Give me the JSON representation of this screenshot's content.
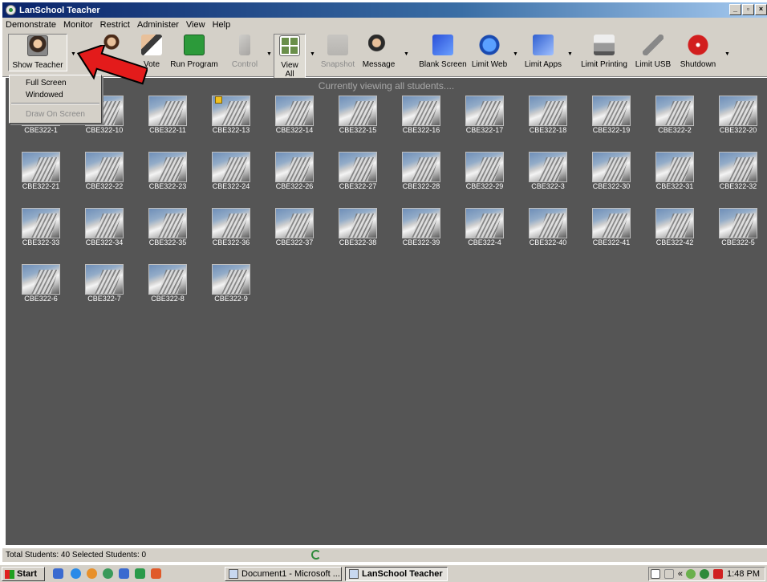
{
  "window": {
    "title": "LanSchool Teacher"
  },
  "menu": [
    "Demonstrate",
    "Monitor",
    "Restrict",
    "Administer",
    "View",
    "Help"
  ],
  "toolbar": {
    "show_teacher": "Show Teacher",
    "vote": "Vote",
    "run_program": "Run Program",
    "control": "Control",
    "view_all": "View All",
    "snapshot": "Snapshot",
    "message": "Message",
    "blank_screen": "Blank Screen",
    "limit_web": "Limit Web",
    "limit_apps": "Limit Apps",
    "limit_printing": "Limit Printing",
    "limit_usb": "Limit USB",
    "shutdown": "Shutdown"
  },
  "dropdown": {
    "full_screen": "Full Screen",
    "windowed": "Windowed",
    "draw_on_screen": "Draw On Screen"
  },
  "viewing_text": "Currently viewing all students....",
  "students": [
    "CBE322-1",
    "CBE322-10",
    "CBE322-11",
    "CBE322-13",
    "CBE322-14",
    "CBE322-15",
    "CBE322-16",
    "CBE322-17",
    "CBE322-18",
    "CBE322-19",
    "CBE322-2",
    "CBE322-20",
    "CBE322-21",
    "CBE322-22",
    "CBE322-23",
    "CBE322-24",
    "CBE322-26",
    "CBE322-27",
    "CBE322-28",
    "CBE322-29",
    "CBE322-3",
    "CBE322-30",
    "CBE322-31",
    "CBE322-32",
    "CBE322-33",
    "CBE322-34",
    "CBE322-35",
    "CBE322-36",
    "CBE322-37",
    "CBE322-38",
    "CBE322-39",
    "CBE322-4",
    "CBE322-40",
    "CBE322-41",
    "CBE322-42",
    "CBE322-5",
    "CBE322-6",
    "CBE322-7",
    "CBE322-8",
    "CBE322-9"
  ],
  "status": "Total Students: 40  Selected Students: 0",
  "taskbar": {
    "start": "Start",
    "task1": "Document1 - Microsoft ...",
    "task2": "LanSchool Teacher",
    "clock": "1:48 PM"
  }
}
